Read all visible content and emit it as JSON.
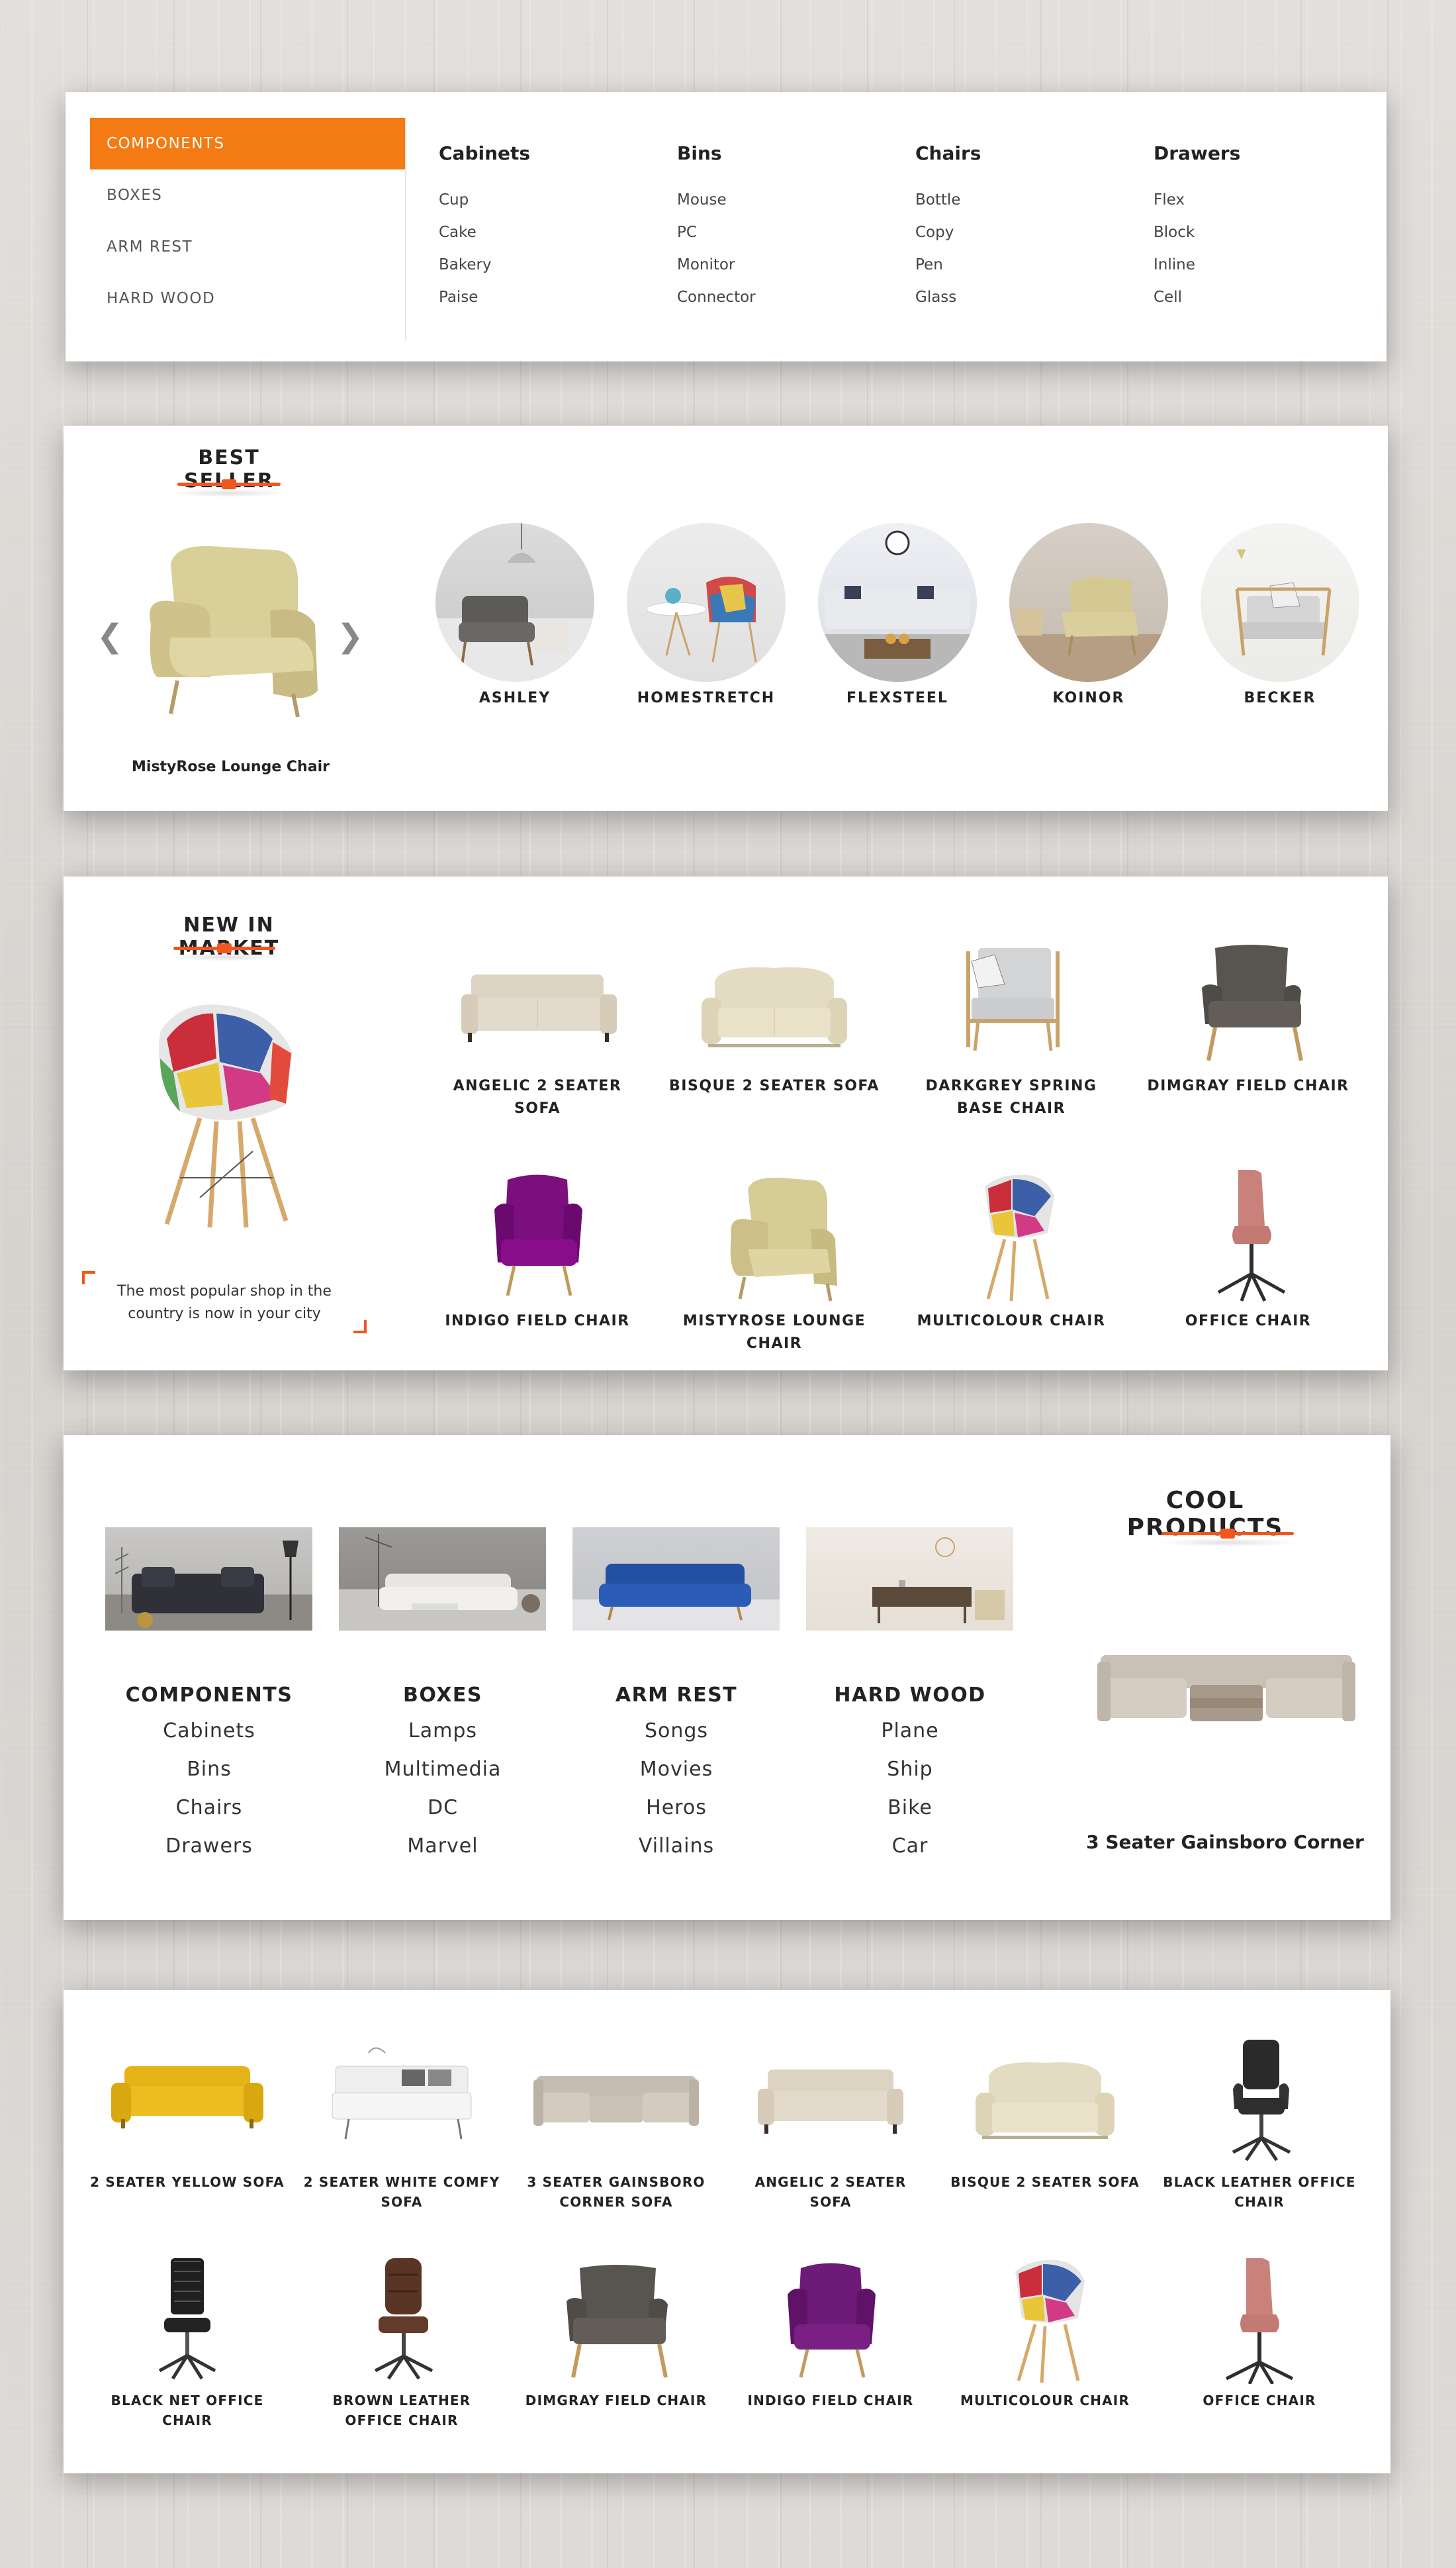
{
  "accent": "#f0561f",
  "menu": {
    "side_items": [
      "COMPONENTS",
      "BOXES",
      "ARM REST",
      "HARD WOOD"
    ],
    "columns": [
      {
        "title": "Cabinets",
        "items": [
          "Cup",
          "Cake",
          "Bakery",
          "Paise"
        ]
      },
      {
        "title": "Bins",
        "items": [
          "Mouse",
          "PC",
          "Monitor",
          "Connector"
        ]
      },
      {
        "title": "Chairs",
        "items": [
          "Bottle",
          "Copy",
          "Pen",
          "Glass"
        ]
      },
      {
        "title": "Drawers",
        "items": [
          "Flex",
          "Block",
          "Inline",
          "Cell"
        ]
      }
    ]
  },
  "best_seller": {
    "title": "BEST SELLER",
    "featured": "MistyRose Lounge Chair",
    "prev_icon": "chevron-left-icon",
    "next_icon": "chevron-right-icon",
    "circles": [
      "ASHLEY",
      "HOMESTRETCH",
      "FLEXSTEEL",
      "KOINOR",
      "BECKER"
    ]
  },
  "new_in_market": {
    "title": "NEW IN MARKET",
    "tagline": "The most popular shop in the country is now in your city",
    "products": [
      "ANGELIC 2 SEATER SOFA",
      "BISQUE 2 SEATER SOFA",
      "DARKGREY SPRING BASE CHAIR",
      "DIMGRAY FIELD CHAIR",
      "INDIGO FIELD CHAIR",
      "MISTYROSE LOUNGE CHAIR",
      "MULTICOLOUR CHAIR",
      "OFFICE CHAIR"
    ]
  },
  "cool_products": {
    "title": "COOL PRODUCTS",
    "featured": "3 Seater Gainsboro Corner",
    "categories": [
      {
        "title": "COMPONENTS",
        "items": [
          "Cabinets",
          "Bins",
          "Chairs",
          "Drawers"
        ]
      },
      {
        "title": "BOXES",
        "items": [
          "Lamps",
          "Multimedia",
          "DC",
          "Marvel"
        ]
      },
      {
        "title": "ARM REST",
        "items": [
          "Songs",
          "Movies",
          "Heros",
          "Villains"
        ]
      },
      {
        "title": "HARD WOOD",
        "items": [
          "Plane",
          "Ship",
          "Bike",
          "Car"
        ]
      }
    ]
  },
  "grid": {
    "products": [
      "2 SEATER YELLOW SOFA",
      "2 SEATER WHITE COMFY SOFA",
      "3 SEATER GAINSBORO CORNER SOFA",
      "ANGELIC 2 SEATER SOFA",
      "BISQUE 2 SEATER SOFA",
      "BLACK LEATHER OFFICE CHAIR",
      "BLACK NET OFFICE CHAIR",
      "BROWN LEATHER OFFICE CHAIR",
      "DIMGRAY FIELD CHAIR",
      "INDIGO FIELD CHAIR",
      "MULTICOLOUR CHAIR",
      "OFFICE CHAIR"
    ]
  }
}
